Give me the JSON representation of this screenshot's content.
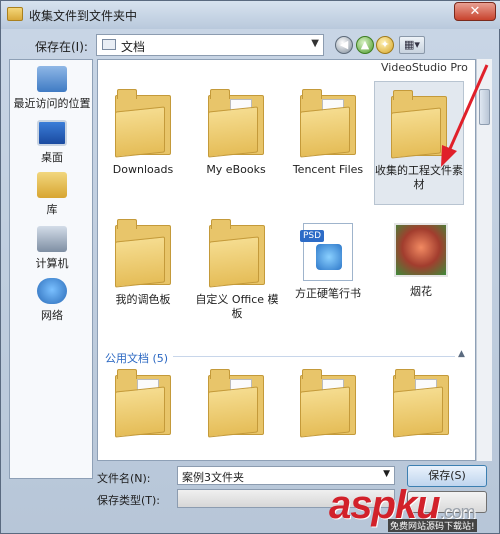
{
  "window": {
    "title": "收集文件到文件夹中",
    "close_label": "✕"
  },
  "toolbar": {
    "lookin_label": "保存在(I):",
    "lookin_value": "文档",
    "view_label": "▦▾"
  },
  "places": [
    {
      "label": "最近访问的位置",
      "icon": "recent-places-icon"
    },
    {
      "label": "桌面",
      "icon": "desktop-icon"
    },
    {
      "label": "库",
      "icon": "library-icon"
    },
    {
      "label": "计算机",
      "icon": "computer-icon"
    },
    {
      "label": "网络",
      "icon": "network-icon"
    }
  ],
  "files": {
    "group_header": "VideoStudio Pro",
    "items": [
      {
        "label": "Downloads",
        "type": "folder"
      },
      {
        "label": "My eBooks",
        "type": "folder"
      },
      {
        "label": "Tencent Files",
        "type": "folder"
      },
      {
        "label": "收集的工程文件素材",
        "type": "folder",
        "selected": true
      },
      {
        "label": "我的调色板",
        "type": "folder"
      },
      {
        "label": "自定义 Office 模板",
        "type": "folder"
      },
      {
        "label": "方正硬笔行书",
        "type": "psd",
        "badge": "PSD"
      },
      {
        "label": "烟花",
        "type": "image"
      }
    ],
    "public_header": "公用文档 (5)"
  },
  "bottom": {
    "filename_label": "文件名(N):",
    "filename_value": "案例3文件夹",
    "filetype_label": "保存类型(T):",
    "save_label": "保存(S)"
  },
  "watermark": {
    "brand": "aspku",
    "tld": ".com",
    "sub": "免费网站源码下载站!"
  },
  "colors": {
    "selection": "#e2e8ef",
    "link": "#2a67c2",
    "annotation": "#e0202a"
  }
}
